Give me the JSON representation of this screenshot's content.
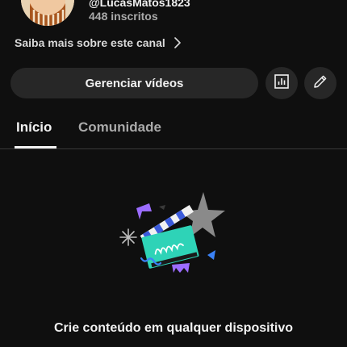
{
  "channel": {
    "handle": "@LucasMatos1823",
    "subscribers": "448 inscritos",
    "about_link": "Saiba mais sobre este canal"
  },
  "actions": {
    "manage_videos": "Gerenciar vídeos",
    "analytics_icon": "analytics-icon",
    "edit_icon": "pencil-icon"
  },
  "tabs": [
    {
      "label": "Início",
      "active": true
    },
    {
      "label": "Comunidade",
      "active": false
    }
  ],
  "empty_state": {
    "title": "Crie conteúdo em qualquer dispositivo",
    "illustration": "clapperboard-illustration"
  },
  "colors": {
    "background": "#0f0f0f",
    "button_bg": "#272727",
    "text_primary": "#f1f1f1",
    "text_secondary": "#aaaaaa",
    "divider": "#3a3a3a",
    "accent_teal": "#2ed3b7",
    "accent_purple": "#9b6cff",
    "accent_blue": "#3b82f6"
  }
}
